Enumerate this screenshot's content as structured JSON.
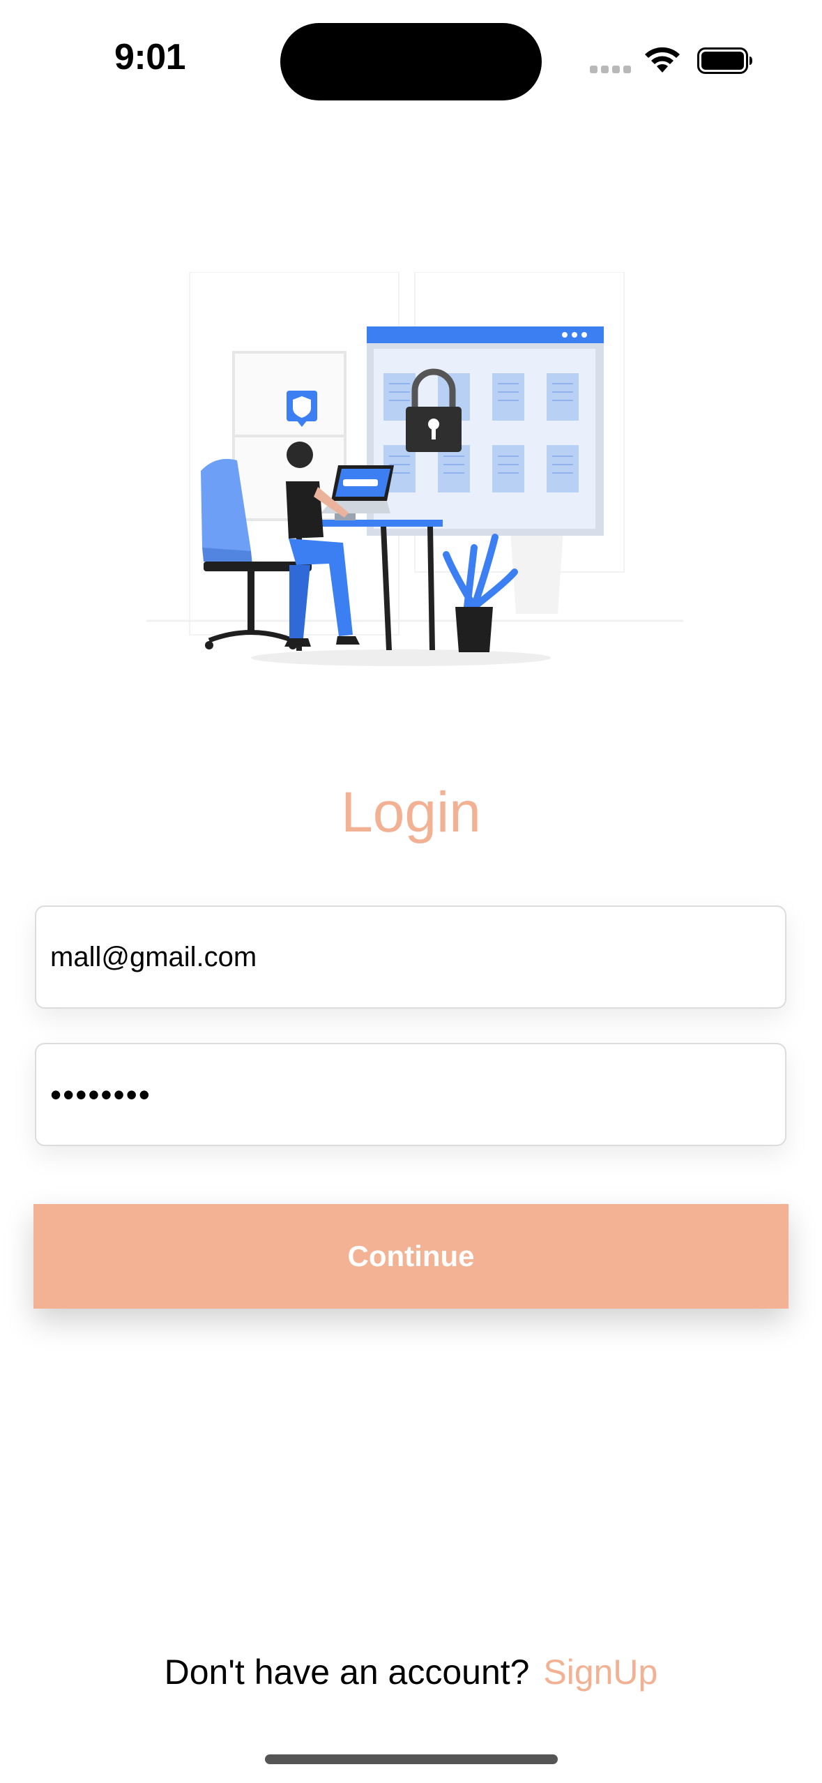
{
  "status_bar": {
    "time": "9:01"
  },
  "login": {
    "title": "Login",
    "email_value": "mall@gmail.com",
    "password_value": "••••••••",
    "continue_label": "Continue"
  },
  "signup": {
    "prompt": "Don't have an account?",
    "link_label": "SignUp"
  },
  "colors": {
    "accent": "#f3b194",
    "illustration_blue": "#3b7ff2"
  },
  "icons": [
    "signal-icon",
    "wifi-icon",
    "battery-icon",
    "padlock-icon",
    "shield-icon"
  ]
}
